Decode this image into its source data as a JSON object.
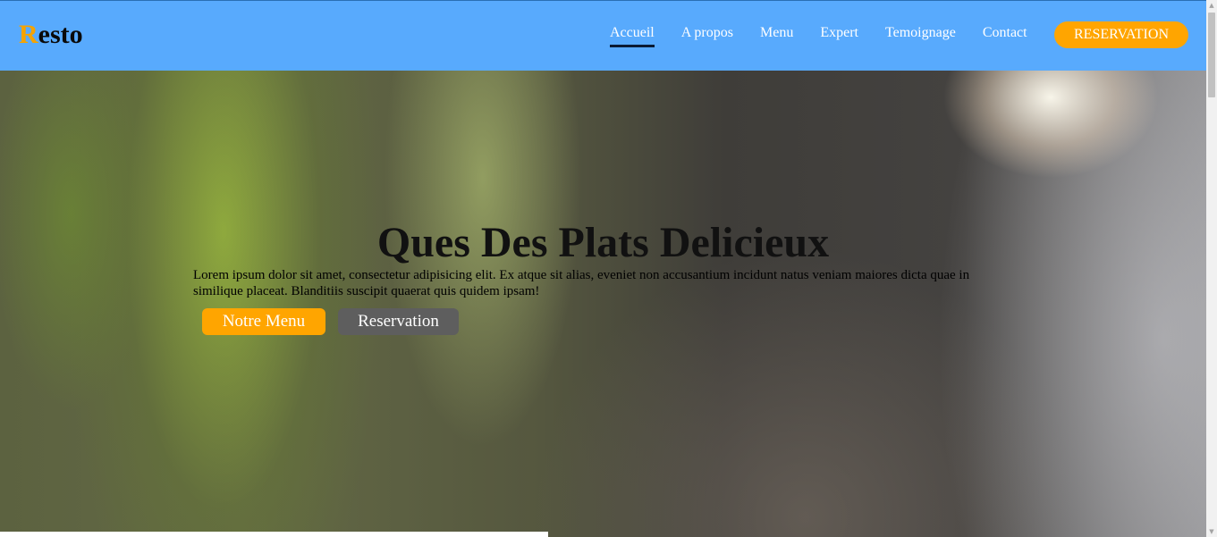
{
  "header": {
    "logo_first": "R",
    "logo_rest": "esto",
    "nav": [
      {
        "label": "Accueil",
        "active": true
      },
      {
        "label": "A propos"
      },
      {
        "label": "Menu"
      },
      {
        "label": "Expert"
      },
      {
        "label": "Temoignage"
      },
      {
        "label": "Contact"
      }
    ],
    "reserve_label": "RESERVATION"
  },
  "hero": {
    "title": "Ques Des Plats Delicieux",
    "text": "Lorem ipsum dolor sit amet, consectetur adipisicing elit. Ex atque sit alias, eveniet non accusantium incidunt natus veniam maiores dicta quae in similique placeat. Blanditiis suscipit quaerat quis quidem ipsam!",
    "btn_menu": "Notre Menu",
    "btn_reservation": "Reservation"
  },
  "colors": {
    "nav_bg": "#58aafd",
    "accent": "#ffa500",
    "secondary_button": "#5e5e5e"
  },
  "icons": {
    "scroll_up": "scroll-up-arrow-icon",
    "scroll_down": "scroll-down-arrow-icon"
  }
}
